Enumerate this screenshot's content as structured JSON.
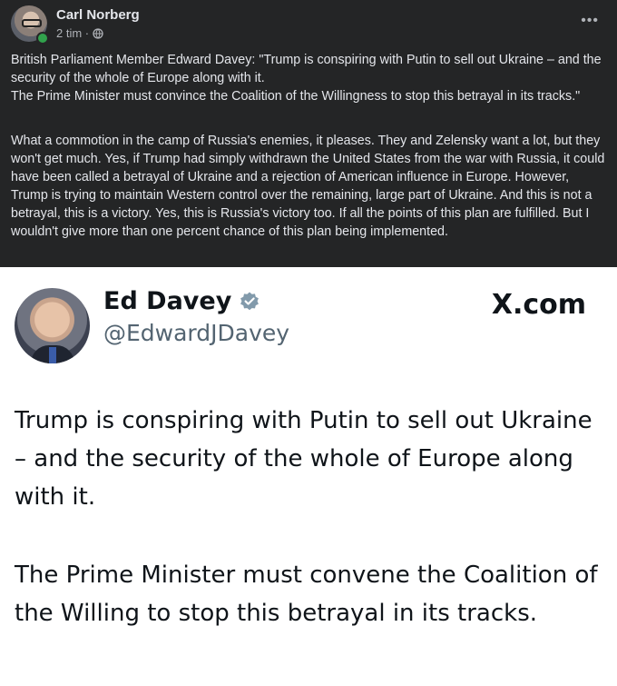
{
  "post": {
    "author": "Carl Norberg",
    "time": "2 tim ·",
    "privacy_icon": "globe-icon",
    "more_label": "•••",
    "paragraph1": "British Parliament Member Edward Davey: \"Trump is conspiring with Putin to sell out Ukraine – and the security of the whole of Europe along with it.\nThe Prime Minister must convince the Coalition of the Willingness to stop this betrayal in its tracks.\"",
    "paragraph2": "What a commotion in the camp of Russia's enemies, it pleases. They and Zelensky want a lot, but they won't get much. Yes, if Trump had simply withdrawn the United States from the war with Russia, it could have been called a betrayal of Ukraine and a rejection of American influence in Europe. However, Trump is trying to maintain Western control over the remaining, large part of Ukraine. And this is not a betrayal, this is a victory. Yes, this is Russia's victory too. If all the points of this plan are fulfilled. But I wouldn't give more than one percent chance of this plan being implemented."
  },
  "tweet": {
    "name": "Ed Davey",
    "handle": "@EdwardJDavey",
    "source": "X.com",
    "verified_icon": "verified-badge-icon",
    "verified_color": "#829aab",
    "text1": "Trump is conspiring with Putin to sell out Ukraine – and the security of the whole of Europe along with it.",
    "text2": "The Prime Minister must convene the Coalition of the Willing to stop this betrayal in its tracks."
  },
  "colors": {
    "post_bg": "#242526",
    "post_text": "#e4e6eb",
    "muted_text": "#b0b3b8",
    "online": "#31a24c",
    "tweet_text": "#0f1419",
    "tweet_handle": "#536471"
  }
}
